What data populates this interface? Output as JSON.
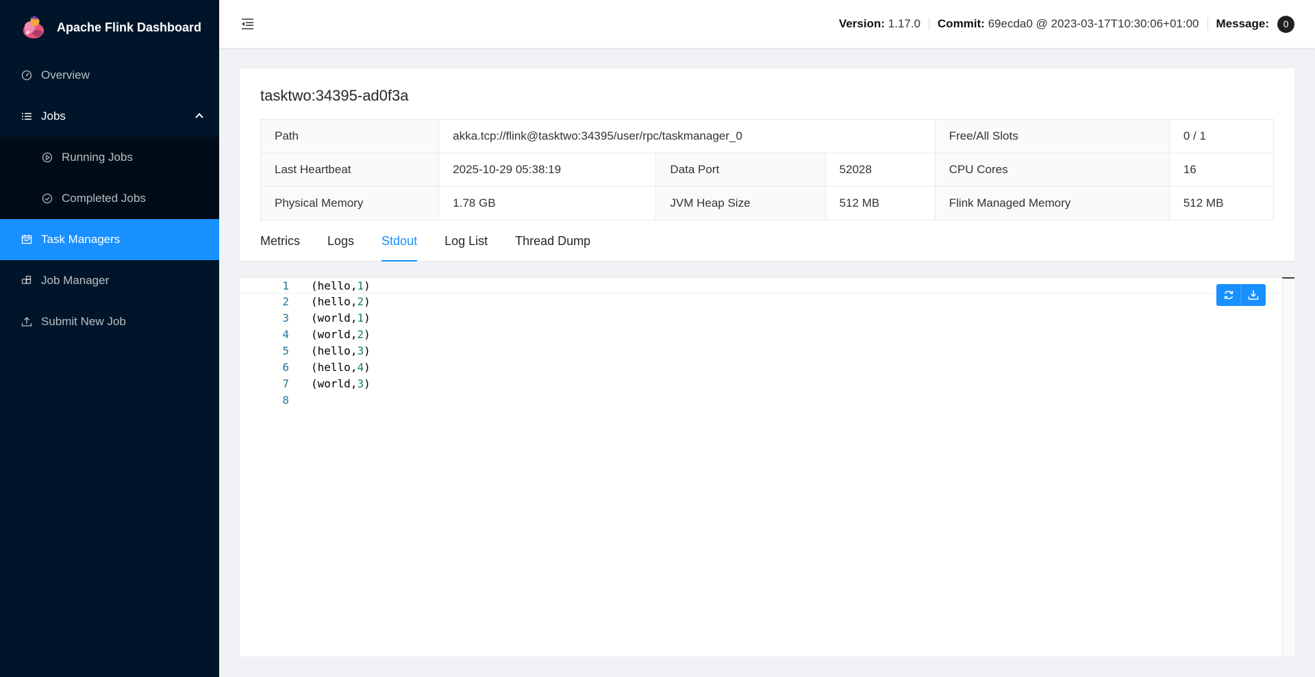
{
  "app": {
    "title": "Apache Flink Dashboard"
  },
  "sidebar": {
    "items": [
      {
        "label": "Overview",
        "icon": "dashboard-icon"
      },
      {
        "label": "Jobs",
        "icon": "list-icon"
      },
      {
        "label": "Running Jobs",
        "icon": "play-circle-icon"
      },
      {
        "label": "Completed Jobs",
        "icon": "check-circle-icon"
      },
      {
        "label": "Task Managers",
        "icon": "schedule-icon"
      },
      {
        "label": "Job Manager",
        "icon": "build-icon"
      },
      {
        "label": "Submit New Job",
        "icon": "upload-icon"
      }
    ]
  },
  "header": {
    "version_label": "Version:",
    "version_value": "1.17.0",
    "commit_label": "Commit:",
    "commit_value": "69ecda0 @ 2023-03-17T10:30:06+01:00",
    "message_label": "Message:",
    "message_count": "0"
  },
  "taskmanager": {
    "title": "tasktwo:34395-ad0f3a",
    "path_label": "Path",
    "path_value": "akka.tcp://flink@tasktwo:34395/user/rpc/taskmanager_0",
    "slots_label": "Free/All Slots",
    "slots_value": "0 / 1",
    "heartbeat_label": "Last Heartbeat",
    "heartbeat_value": "2025-10-29 05:38:19",
    "dataport_label": "Data Port",
    "dataport_value": "52028",
    "cpu_label": "CPU Cores",
    "cpu_value": "16",
    "memory_label": "Physical Memory",
    "memory_value": "1.78 GB",
    "heap_label": "JVM Heap Size",
    "heap_value": "512 MB",
    "managed_label": "Flink Managed Memory",
    "managed_value": "512 MB"
  },
  "tabs": [
    "Metrics",
    "Logs",
    "Stdout",
    "Log List",
    "Thread Dump"
  ],
  "active_tab": "Stdout",
  "stdout": {
    "lines": [
      {
        "no": "1",
        "word": "hello",
        "count": "1"
      },
      {
        "no": "2",
        "word": "hello",
        "count": "2"
      },
      {
        "no": "3",
        "word": "world",
        "count": "1"
      },
      {
        "no": "4",
        "word": "world",
        "count": "2"
      },
      {
        "no": "5",
        "word": "hello",
        "count": "3"
      },
      {
        "no": "6",
        "word": "hello",
        "count": "4"
      },
      {
        "no": "7",
        "word": "world",
        "count": "3"
      },
      {
        "no": "8",
        "word": "",
        "count": ""
      }
    ]
  },
  "colors": {
    "sidebar_bg": "#001529",
    "accent": "#1890ff"
  }
}
